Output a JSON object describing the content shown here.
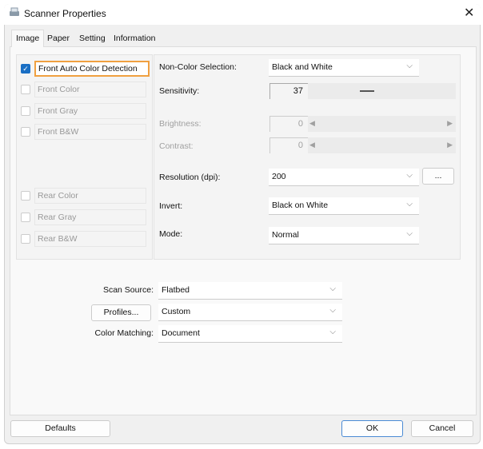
{
  "window": {
    "title": "Scanner Properties"
  },
  "tabs": [
    {
      "label": "Image"
    },
    {
      "label": "Paper"
    },
    {
      "label": "Setting"
    },
    {
      "label": "Information"
    }
  ],
  "front_options": [
    {
      "label": "Front Auto Color Detection",
      "checked": true
    },
    {
      "label": "Front Color",
      "checked": false
    },
    {
      "label": "Front Gray",
      "checked": false
    },
    {
      "label": "Front B&W",
      "checked": false
    }
  ],
  "rear_options": [
    {
      "label": "Rear Color",
      "checked": false
    },
    {
      "label": "Rear Gray",
      "checked": false
    },
    {
      "label": "Rear B&W",
      "checked": false
    }
  ],
  "settings": {
    "non_color_label": "Non-Color Selection:",
    "non_color_value": "Black and White",
    "sensitivity_label": "Sensitivity:",
    "sensitivity_value": "37",
    "brightness_label": "Brightness:",
    "brightness_value": "0",
    "contrast_label": "Contrast:",
    "contrast_value": "0",
    "resolution_label": "Resolution (dpi):",
    "resolution_value": "200",
    "resolution_more": "...",
    "invert_label": "Invert:",
    "invert_value": "Black on White",
    "mode_label": "Mode:",
    "mode_value": "Normal"
  },
  "bottom": {
    "scan_source_label": "Scan Source:",
    "scan_source_value": "Flatbed",
    "profiles_button": "Profiles...",
    "profiles_value": "Custom",
    "color_matching_label": "Color Matching:",
    "color_matching_value": "Document"
  },
  "buttons": {
    "defaults": "Defaults",
    "ok": "OK",
    "cancel": "Cancel"
  }
}
